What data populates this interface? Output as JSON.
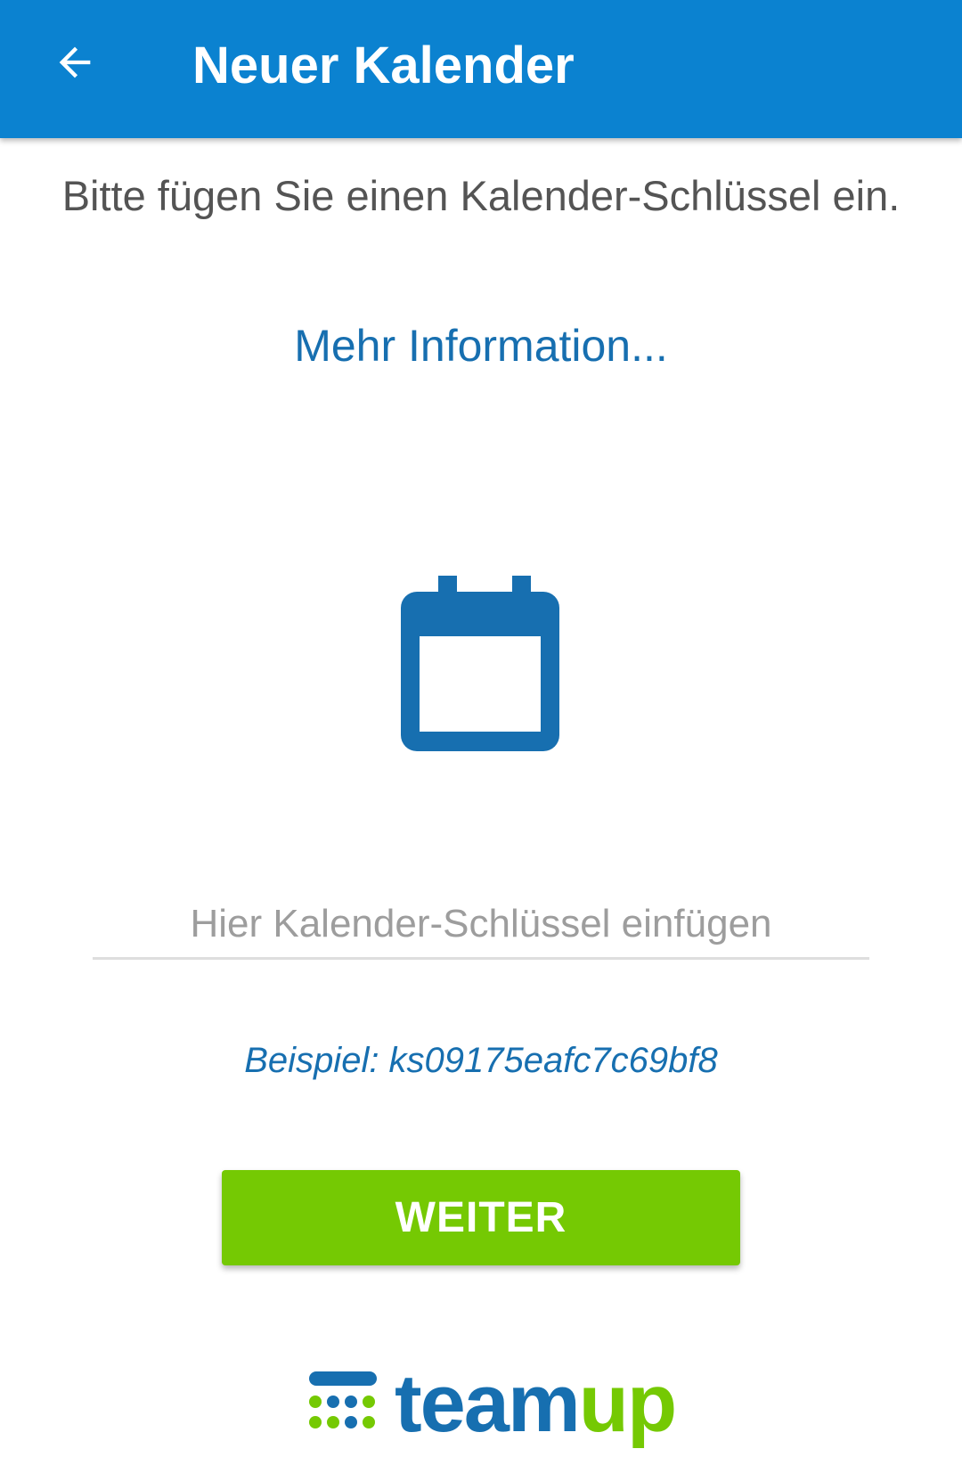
{
  "app_bar": {
    "title": "Neuer Kalender",
    "back_icon": "arrow-left-icon",
    "color": "#0b82d0"
  },
  "main": {
    "instruction": "Bitte fügen Sie einen Kalender-Schlüssel ein.",
    "more_info_link": "Mehr Information...",
    "calendar_icon": "calendar-icon",
    "icon_color": "#176fb0",
    "key_input": {
      "value": "",
      "placeholder": "Hier Kalender-Schlüssel einfügen"
    },
    "example": "Beispiel: ks09175eafc7c69bf8",
    "continue_button": "WEITER",
    "button_color": "#75c903"
  },
  "footer": {
    "logo_part1": "team",
    "logo_part2": "up",
    "logo_part1_color": "#176fb0",
    "logo_part2_color": "#75c903"
  }
}
